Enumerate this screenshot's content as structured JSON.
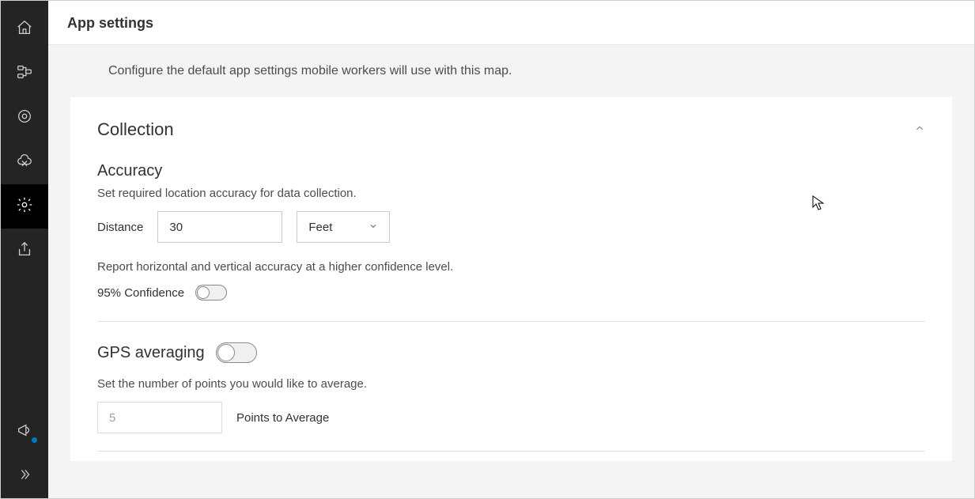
{
  "header": {
    "title": "App settings"
  },
  "intro": "Configure the default app settings mobile workers will use with this map.",
  "collection": {
    "title": "Collection",
    "accuracy": {
      "title": "Accuracy",
      "description": "Set required location accuracy for data collection.",
      "distance_label": "Distance",
      "distance_value": "30",
      "unit_selected": "Feet",
      "report_desc": "Report horizontal and vertical accuracy at a higher confidence level.",
      "confidence_label": "95% Confidence",
      "confidence_on": false
    },
    "gps": {
      "title": "GPS averaging",
      "toggle_on": false,
      "description": "Set the number of points you would like to average.",
      "points_value": "5",
      "points_label": "Points to Average"
    }
  },
  "sidebar_icons": [
    "home",
    "layers",
    "target",
    "cloud",
    "settings",
    "share",
    "announce",
    "expand"
  ]
}
